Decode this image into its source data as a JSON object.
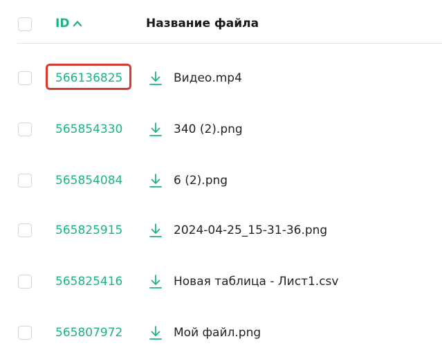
{
  "accent_color": "#1db37a",
  "highlight_color": "#d9382f",
  "header": {
    "id_label": "ID",
    "sort_direction_icon": "chevron-up-icon",
    "name_label": "Название файла"
  },
  "rows": [
    {
      "id": "566136825",
      "name": "Видео.mp4",
      "highlighted": true
    },
    {
      "id": "565854330",
      "name": "340 (2).png",
      "highlighted": false
    },
    {
      "id": "565854084",
      "name": "6 (2).png",
      "highlighted": false
    },
    {
      "id": "565825915",
      "name": "2024-04-25_15-31-36.png",
      "highlighted": false
    },
    {
      "id": "565825416",
      "name": "Новая таблица - Лист1.csv",
      "highlighted": false
    },
    {
      "id": "565807972",
      "name": "Мой файл.png",
      "highlighted": false
    }
  ],
  "row_icon": "download-icon"
}
